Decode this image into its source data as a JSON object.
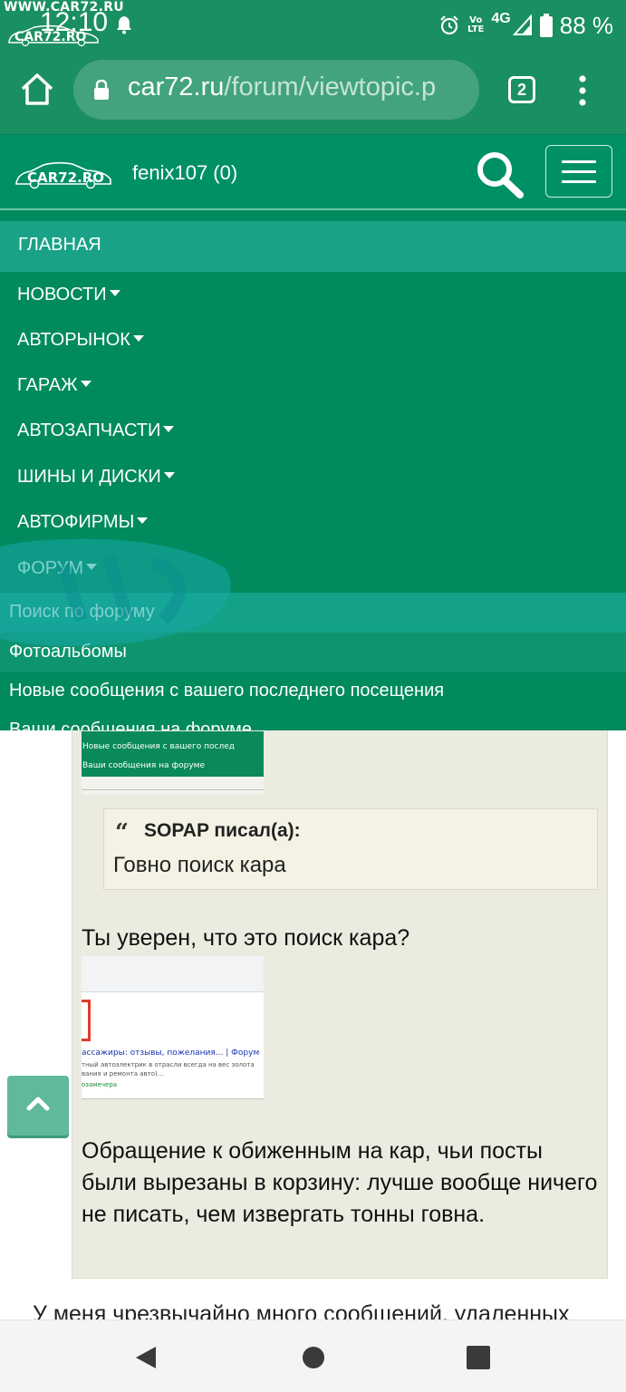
{
  "status_bar": {
    "watermark_text": "WWW.CAR72.RU",
    "watermark_logo_text": "CAR72.RO",
    "time": "12:10",
    "volte_label_top": "Vo",
    "volte_label_bottom": "LTE",
    "network_label": "4G",
    "battery_percent": "88 %"
  },
  "browser": {
    "url_domain": "car72.ru",
    "url_path": "/forum/viewtopic.p",
    "tab_count": "2"
  },
  "header": {
    "logo_text": "CAR72.RO",
    "username": "fenix107 (0)"
  },
  "nav": {
    "main_label": "ГЛАВНАЯ",
    "items": [
      {
        "label": "НОВОСТИ"
      },
      {
        "label": "АВТОРЫНОК"
      },
      {
        "label": "ГАРАЖ"
      },
      {
        "label": "АВТОЗАПЧАСТИ"
      },
      {
        "label": "ШИНЫ И ДИСКИ"
      },
      {
        "label": "АВТОФИРМЫ"
      },
      {
        "label": "ФОРУМ"
      }
    ],
    "forum_submenu": [
      {
        "label": "Поиск по форуму"
      },
      {
        "label": "Фотоальбомы"
      },
      {
        "label": "Новые сообщения с вашего последнего посещения"
      },
      {
        "label": "Ваши сообщения на форуме"
      }
    ]
  },
  "post": {
    "thumb1_lines": [
      "Новые сообщения с вашего послед",
      "Ваши сообщения на форуме"
    ],
    "quote_author": "SOPAP писал(а):",
    "quote_text": "Говно поиск кара",
    "text1": "Ты уверен, что это поиск кара?",
    "thumb2_lines": [
      "ассажиры: отзывы, пожелания... | Форум",
      "тный автоэлектрик в отрасли всегда на вес золота",
      "вания и ремонта авто)...",
      "озамечера"
    ],
    "text2": "Обращение к обиженным на кар, чьи посты были вырезаны в корзину: лучше вообще ничего не писать, чем извергать тонны говна.",
    "cut_text": "У меня чрезвычайно много сообщений, удаленных"
  },
  "colors": {
    "primary_green": "#009066",
    "nav_green": "#008a5e",
    "main_highlight": "#1aa286",
    "post_background": "#ecebe0"
  }
}
